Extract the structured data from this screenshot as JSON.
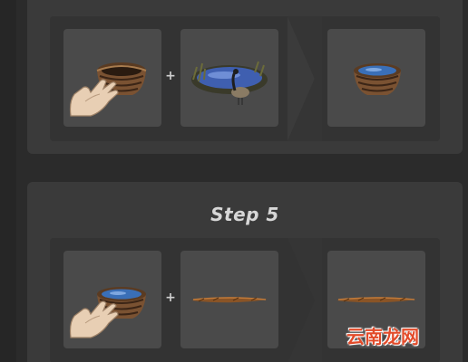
{
  "steps": [
    {
      "title": "",
      "ingredients": [
        {
          "icon": "bucket-icon",
          "action": "hand-icon"
        },
        {
          "icon": "pond-with-goose-icon"
        }
      ],
      "result": {
        "icon": "bucket-with-water-icon"
      },
      "plus": "+"
    },
    {
      "title": "Step 5",
      "ingredients": [
        {
          "icon": "bucket-with-water-icon",
          "action": "hand-icon"
        },
        {
          "icon": "long-twig-icon"
        }
      ],
      "result": {
        "icon": "long-twig-icon"
      },
      "plus": "+"
    }
  ],
  "watermark": "云南龙网",
  "colors": {
    "background": "#2b2b2b",
    "panel": "#3a3a3a",
    "row": "#333333",
    "slot": "#4a4a4a",
    "watermark": "#e24b2a"
  }
}
